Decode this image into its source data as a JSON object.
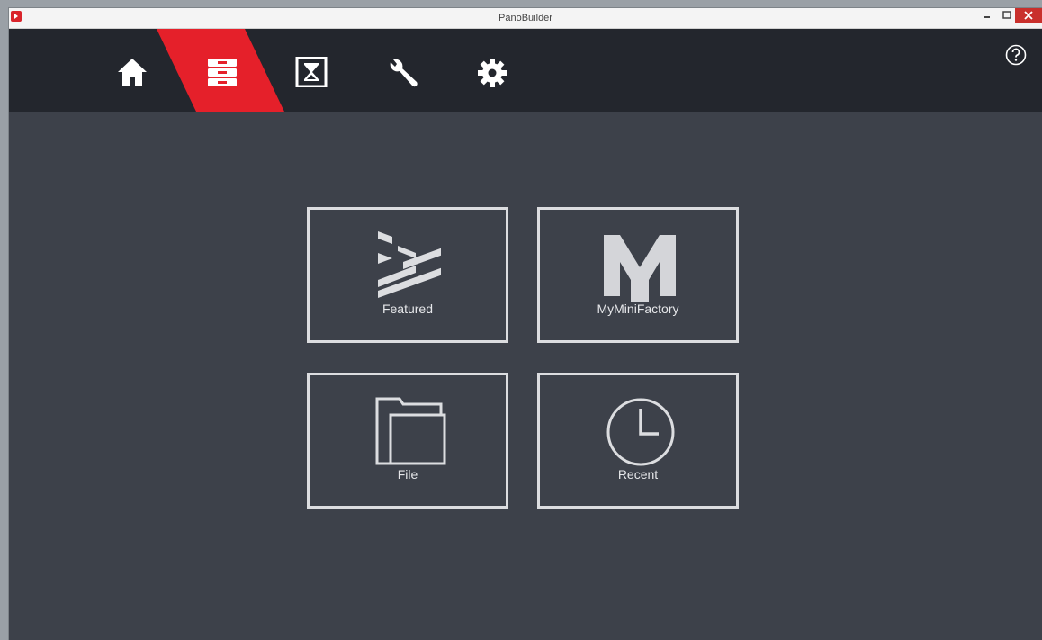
{
  "window": {
    "title": "PanoBuilder"
  },
  "toolbar": {
    "items": [
      {
        "icon": "home-icon",
        "active": false
      },
      {
        "icon": "library-icon",
        "active": true
      },
      {
        "icon": "hourglass-icon",
        "active": false
      },
      {
        "icon": "wrench-icon",
        "active": false
      },
      {
        "icon": "gear-icon",
        "active": false
      }
    ],
    "help_icon": "help-icon"
  },
  "tiles": [
    {
      "label": "Featured",
      "icon": "featured-arrows-icon"
    },
    {
      "label": "MyMiniFactory",
      "icon": "myminifactory-logo-icon"
    },
    {
      "label": "File",
      "icon": "folder-icon"
    },
    {
      "label": "Recent",
      "icon": "clock-icon"
    }
  ],
  "colors": {
    "toolbar_bg": "#23262d",
    "content_bg": "#3d414a",
    "accent": "#e5202a",
    "tile_border": "#dcdde0"
  }
}
